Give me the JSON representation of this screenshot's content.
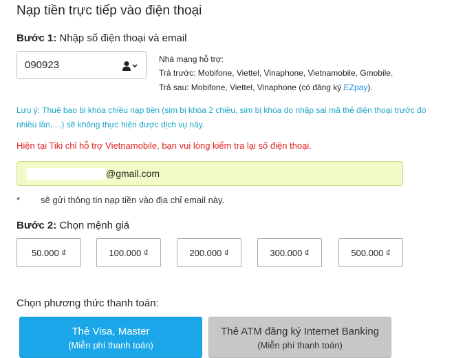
{
  "page": {
    "title": "Nạp tiền trực tiếp vào điện thoại"
  },
  "step1": {
    "label": "Bước 1:",
    "text": "Nhập số điện thoại và email",
    "phone_value": "090923",
    "contact_icon": "contact-dropdown-icon"
  },
  "carriers": {
    "heading": "Nhà mạng hỗ trợ:",
    "prepaid": "Trả trước: Mobifone, Viettel, Vinaphone, Vietnamobile, Gmobile.",
    "postpaid_prefix": "Trả sau: Mobifone, Viettel, Vinaphone (có đăng ký ",
    "postpaid_link": "EZpay",
    "postpaid_suffix": ")."
  },
  "note": {
    "line1": "Lưu ý: Thuê bao bị khóa chiều nạp tiền (sim bị khóa 2 chiều, sim bị khóa do nhập sai mã thẻ điện thoại trước đó",
    "line2": "nhiều lần, ...) sẽ không thực hiện được dịch vụ này."
  },
  "warning": "Hiện tại Tiki chỉ hỗ trợ Vietnamobile, bạn vui lòng kiểm tra lại số điện thoại.",
  "email": {
    "value": "@gmail.com",
    "note_star": "*",
    "note": "sẽ gửi thông tin nạp tiền vào địa chỉ email này."
  },
  "step2": {
    "label": "Bước 2:",
    "text": "Chọn mệnh giá",
    "denominations": [
      "50.000 ₫",
      "100.000 ₫",
      "200.000 ₫",
      "300.000 ₫",
      "500.000 ₫"
    ]
  },
  "payment": {
    "label": "Chọn phương thức thanh toán:",
    "visa": {
      "line1": "Thẻ Visa, Master",
      "line2": "(Miễn phí thanh toán)"
    },
    "atm": {
      "line1": "Thẻ ATM đăng ký Internet Banking",
      "line2": "(Miễn phí thanh toán)"
    }
  },
  "colors": {
    "accent_blue": "#1aa6e8",
    "note_cyan": "#1ba4c8",
    "warning_red": "#e01e1e",
    "email_bg": "#f3f9c7"
  }
}
